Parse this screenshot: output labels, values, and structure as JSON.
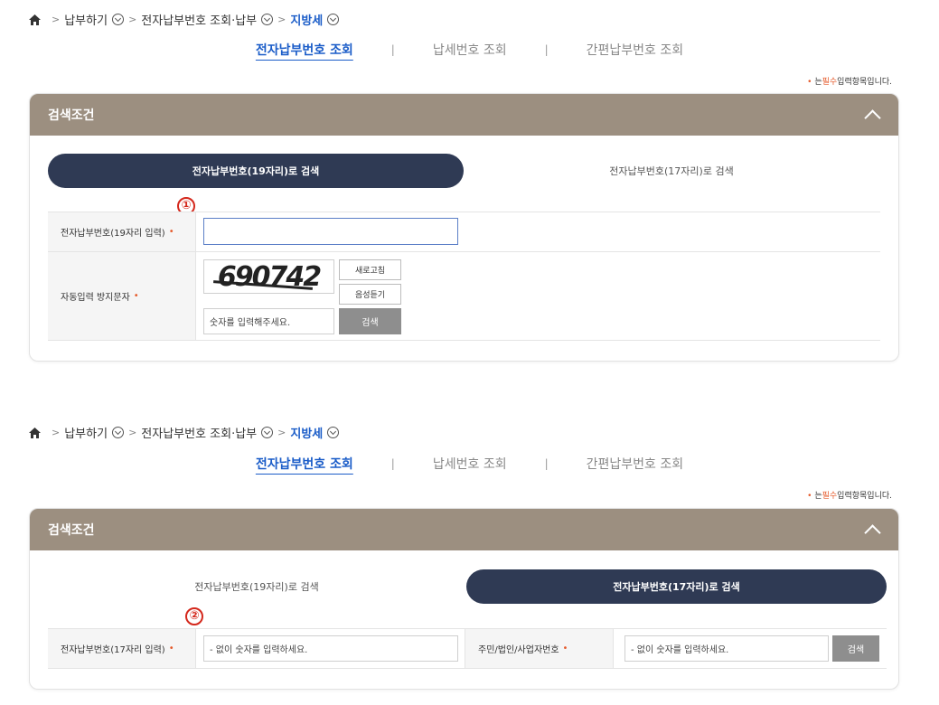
{
  "top": {
    "breadcrumb": {
      "items": [
        "납부하기",
        "전자납부번호 조회·납부",
        "지방세"
      ]
    },
    "tabs": [
      "전자납부번호 조회",
      "납세번호 조회",
      "간편납부번호 조회"
    ],
    "required_note": {
      "dot": "•",
      "prefix": "는",
      "red": "필수",
      "suffix": "입력항목입니다."
    },
    "panel_title": "검색조건",
    "segments": [
      "전자납부번호(19자리)로 검색",
      "전자납부번호(17자리)로 검색"
    ],
    "marker": "①",
    "row1_label": "전자납부번호(19자리 입력)",
    "row2_label": "자동입력 방지문자",
    "captcha_text": "690742",
    "refresh_btn": "새로고침",
    "audio_btn": "음성듣기",
    "captcha_placeholder": "숫자를 입력해주세요.",
    "search_btn": "검색",
    "star": "•"
  },
  "bottom": {
    "breadcrumb": {
      "items": [
        "납부하기",
        "전자납부번호 조회·납부",
        "지방세"
      ]
    },
    "tabs": [
      "전자납부번호 조회",
      "납세번호 조회",
      "간편납부번호 조회"
    ],
    "required_note": {
      "dot": "•",
      "prefix": "는",
      "red": "필수",
      "suffix": "입력항목입니다."
    },
    "panel_title": "검색조건",
    "segments": [
      "전자납부번호(19자리)로 검색",
      "전자납부번호(17자리)로 검색"
    ],
    "marker": "②",
    "row1_label": "전자납부번호(17자리 입력)",
    "row1_placeholder": "- 없이 숫자를 입력하세요.",
    "row2_label": "주민/법인/사업자번호",
    "row2_placeholder": "- 없이 숫자를 입력하세요.",
    "search_btn": "검색",
    "star": "•"
  },
  "colors": {
    "header": "#9c8f80",
    "active_segment": "#2f3a54",
    "link": "#1a5cc8",
    "required": "#e55a2b",
    "marker": "#d4281c"
  }
}
